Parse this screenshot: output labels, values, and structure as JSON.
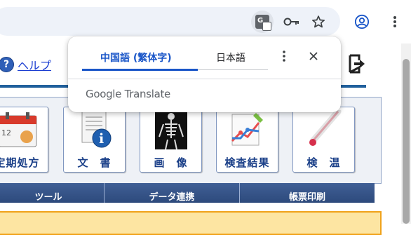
{
  "browser": {
    "translate_icon": "google-translate-icon",
    "translate_glyph": "G",
    "key_icon": "key-icon",
    "star_icon": "star-icon",
    "profile_icon": "profile-icon",
    "menu_icon": "kebab-menu-icon"
  },
  "translate_popup": {
    "tab_source": "中国語 (繁体字)",
    "tab_target": "日本語",
    "more_icon": "more-vert-icon",
    "close_icon": "close-icon",
    "brand": "Google Translate",
    "accent_color": "#1a56c8"
  },
  "app": {
    "help_label": "ヘルプ",
    "help_icon_glyph": "?",
    "tiles": [
      {
        "label": "定期処方",
        "icon": "calendar-icon"
      },
      {
        "label": "文　書",
        "icon": "document-info-icon"
      },
      {
        "label": "画　像",
        "icon": "xray-icon"
      },
      {
        "label": "検査結果",
        "icon": "chart-icon"
      },
      {
        "label": "検　温",
        "icon": "thermometer-icon"
      }
    ],
    "tabs": [
      "ツール",
      "データ連携",
      "帳票印刷"
    ],
    "colors": {
      "header_blue": "#20609c",
      "tab_blue": "#2d4a7c",
      "panel_orange": "#f0a21a",
      "panel_yellow": "#fde5a2"
    }
  }
}
